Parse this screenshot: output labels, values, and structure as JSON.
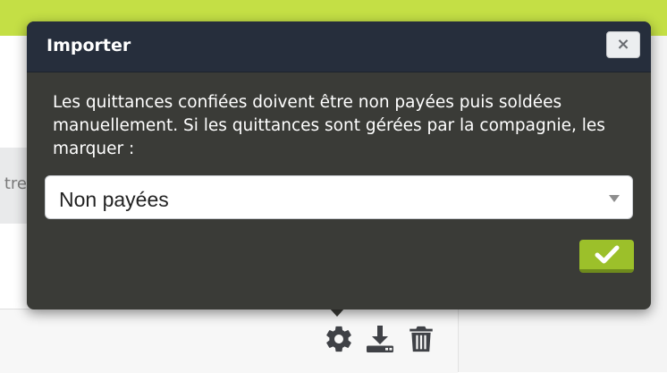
{
  "background": {
    "fragment_text": "tre",
    "toolbar": {
      "settings_icon": "gear-icon",
      "download_icon": "download-icon",
      "delete_icon": "trash-icon"
    }
  },
  "dialog": {
    "title": "Importer",
    "close_icon": "close-icon",
    "close_glyph": "×",
    "message": "Les quittances confiées doivent être non payées puis soldées manuellement. Si les quittances sont gérées par la compagnie, les marquer :",
    "select": {
      "value": "Non payées",
      "caret_icon": "caret-down-icon"
    },
    "confirm_icon": "checkmark-icon"
  },
  "colors": {
    "top_bar": "#c4df45",
    "dialog_body": "#3a3b37",
    "dialog_header": "#262e3c",
    "confirm_button": "#9cc02a"
  }
}
